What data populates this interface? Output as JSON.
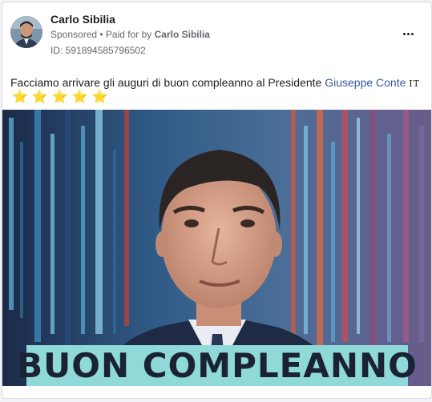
{
  "post": {
    "author": "Carlo Sibilia",
    "sponsored": "Sponsored",
    "paid_prefix": " • Paid for by ",
    "paid_by": "Carlo Sibilia",
    "ad_id": "ID: 591894585796502",
    "text": "Facciamo arrivare gli auguri di buon compleanno al Presidente ",
    "mention": "Giuseppe Conte",
    "mention_badge": "IT",
    "stars": [
      "⭐",
      "⭐",
      "⭐",
      "⭐",
      "⭐"
    ],
    "more_icon": "ellipsis-icon"
  },
  "image": {
    "banner_text": "BUON COMPLEANNO",
    "banner_color": "#8fd9d9"
  },
  "colors": {
    "link": "#385898",
    "star": "#f7b928",
    "secondary_text": "#65676b"
  }
}
